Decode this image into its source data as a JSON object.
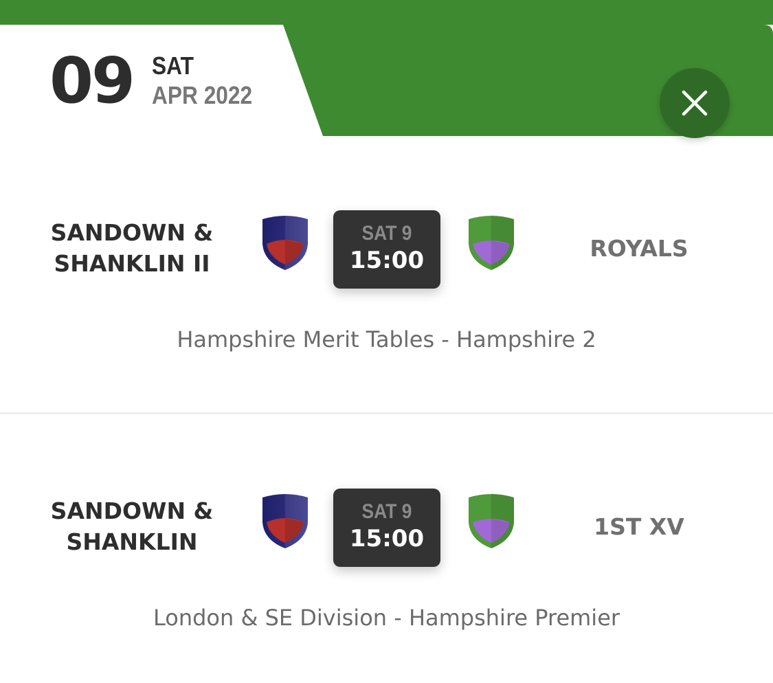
{
  "header": {
    "day_number": "09",
    "weekday": "SAT",
    "month_year": "APR 2022",
    "accent_color": "#3e8a31",
    "close_icon": "close-icon"
  },
  "fixtures": [
    {
      "home_team": "SANDOWN & SHANKLIN II",
      "away_team": "ROYALS",
      "day_label": "SAT 9",
      "kickoff": "15:00",
      "competition": "Hampshire Merit Tables - Hampshire 2",
      "home_crest": "navy-red-shield-icon",
      "away_crest": "green-purple-shield-icon"
    },
    {
      "home_team": "SANDOWN & SHANKLIN",
      "away_team": "1ST XV",
      "day_label": "SAT 9",
      "kickoff": "15:00",
      "competition": "London & SE Division - Hampshire Premier",
      "home_crest": "navy-red-shield-icon",
      "away_crest": "green-purple-shield-icon"
    }
  ],
  "colors": {
    "home_crest_primary": "#2b2a78",
    "home_crest_secondary": "#b7302b",
    "away_crest_primary": "#4f9a3a",
    "away_crest_secondary": "#a06ad6",
    "time_box": "#333333"
  }
}
